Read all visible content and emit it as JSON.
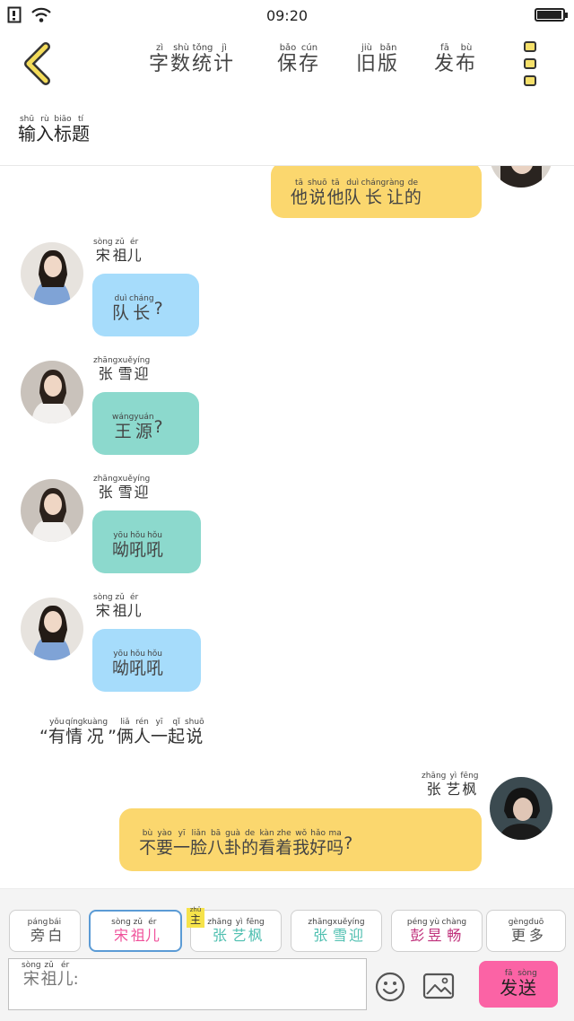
{
  "status_bar": {
    "time": "09:20",
    "battery_level": 0.95
  },
  "toolbar": {
    "word_count": {
      "chars": [
        "字",
        "数",
        "统",
        "计"
      ],
      "pinyin": [
        "zì",
        "shù",
        "tǒng",
        "jì"
      ]
    },
    "save": {
      "chars": [
        "保",
        "存"
      ],
      "pinyin": [
        "bǎo",
        "cún"
      ]
    },
    "old_version": {
      "chars": [
        "旧",
        "版"
      ],
      "pinyin": [
        "jiù",
        "bǎn"
      ]
    },
    "publish": {
      "chars": [
        "发",
        "布"
      ],
      "pinyin": [
        "fā",
        "bù"
      ]
    }
  },
  "title_input": {
    "chars": [
      "输",
      "入",
      "标",
      "题"
    ],
    "pinyin": [
      "shū",
      "rù",
      "biāo",
      "tí"
    ]
  },
  "messages": [
    {
      "side": "right",
      "color": "yellow",
      "text": {
        "chars": [
          "他",
          "说",
          "他",
          "队",
          "长",
          "让",
          "的"
        ],
        "pinyin": [
          "tā",
          "shuō",
          "tā",
          "duì",
          "cháng",
          "ràng",
          "de"
        ]
      }
    },
    {
      "side": "left",
      "color": "blue",
      "sender": {
        "chars": [
          "宋",
          "祖",
          "儿"
        ],
        "pinyin": [
          "sòng",
          "zǔ",
          "ér"
        ]
      },
      "text": {
        "chars": [
          "队",
          "长",
          "?"
        ],
        "pinyin": [
          "duì",
          "cháng",
          ""
        ]
      }
    },
    {
      "side": "left",
      "color": "teal",
      "sender": {
        "chars": [
          "张",
          "雪",
          "迎"
        ],
        "pinyin": [
          "zhāng",
          "xuě",
          "yíng"
        ]
      },
      "text": {
        "chars": [
          "王",
          "源",
          "?"
        ],
        "pinyin": [
          "wáng",
          "yuán",
          ""
        ]
      }
    },
    {
      "side": "left",
      "color": "teal",
      "sender": {
        "chars": [
          "张",
          "雪",
          "迎"
        ],
        "pinyin": [
          "zhāng",
          "xuě",
          "yíng"
        ]
      },
      "text": {
        "chars": [
          "呦",
          "吼",
          "吼"
        ],
        "pinyin": [
          "yōu",
          "hǒu",
          "hǒu"
        ]
      }
    },
    {
      "side": "left",
      "color": "blue",
      "sender": {
        "chars": [
          "宋",
          "祖",
          "儿"
        ],
        "pinyin": [
          "sòng",
          "zǔ",
          "ér"
        ]
      },
      "text": {
        "chars": [
          "呦",
          "吼",
          "吼"
        ],
        "pinyin": [
          "yōu",
          "hǒu",
          "hǒu"
        ]
      }
    },
    {
      "side": "right",
      "color": "yellow",
      "sender": {
        "chars": [
          "张",
          "艺",
          "枫"
        ],
        "pinyin": [
          "zhāng",
          "yì",
          "fēng"
        ]
      },
      "text": {
        "chars": [
          "不",
          "要",
          "一",
          "脸",
          "八",
          "卦",
          "的",
          "看",
          "着",
          "我",
          "好",
          "吗",
          "?"
        ],
        "pinyin": [
          "bù",
          "yào",
          "yī",
          "liǎn",
          "bā",
          "guà",
          "de",
          "kàn",
          "zhe",
          "wǒ",
          "hǎo",
          "ma",
          ""
        ]
      }
    }
  ],
  "narration": {
    "chars": [
      "“",
      "有",
      "情",
      "况",
      "”",
      "俩",
      "人",
      "一",
      "起",
      "说"
    ],
    "pinyin": [
      "",
      "yǒu",
      "qíng",
      "kuàng",
      "",
      "liǎ",
      "rén",
      "yī",
      "qǐ",
      "shuō"
    ]
  },
  "characters": [
    {
      "chars": [
        "旁",
        "白"
      ],
      "pinyin": [
        "páng",
        "bái"
      ],
      "color": "#555555",
      "active": false
    },
    {
      "chars": [
        "宋",
        "祖",
        "儿"
      ],
      "pinyin": [
        "sòng",
        "zǔ",
        "ér"
      ],
      "color": "#f0509a",
      "active": true
    },
    {
      "chars": [
        "张",
        "艺",
        "枫"
      ],
      "pinyin": [
        "zhāng",
        "yì",
        "fēng"
      ],
      "color": "#4fbfb0",
      "active": false,
      "tag": {
        "chars": [
          "主"
        ],
        "pinyin": [
          "zhǔ"
        ]
      }
    },
    {
      "chars": [
        "张",
        "雪",
        "迎"
      ],
      "pinyin": [
        "zhāng",
        "xuě",
        "yíng"
      ],
      "color": "#4fbfb0",
      "active": false
    },
    {
      "chars": [
        "彭",
        "昱",
        "畅"
      ],
      "pinyin": [
        "péng",
        "yù",
        "chàng"
      ],
      "color": "#c0327c",
      "active": false
    },
    {
      "chars": [
        "更",
        "多"
      ],
      "pinyin": [
        "gèng",
        "duō"
      ],
      "color": "#555555",
      "active": false
    }
  ],
  "message_input": {
    "chars": [
      "宋",
      "祖",
      "儿",
      ":"
    ],
    "pinyin": [
      "sòng",
      "zǔ",
      "ér",
      ""
    ]
  },
  "send_button": {
    "chars": [
      "发",
      "送"
    ],
    "pinyin": [
      "fā",
      "sòng"
    ]
  },
  "icons": {
    "back": "back-arrow-icon",
    "more": "more-menu-icon",
    "emoji": "emoji-icon",
    "image": "image-icon",
    "wifi": "wifi-icon",
    "notification": "notification-icon"
  },
  "colors": {
    "yellow_bubble": "#fbd76e",
    "blue_bubble": "#a6dcfb",
    "teal_bubble": "#8cd9cd",
    "send_button": "#fb63a5",
    "active_border": "#5b9bd5"
  }
}
